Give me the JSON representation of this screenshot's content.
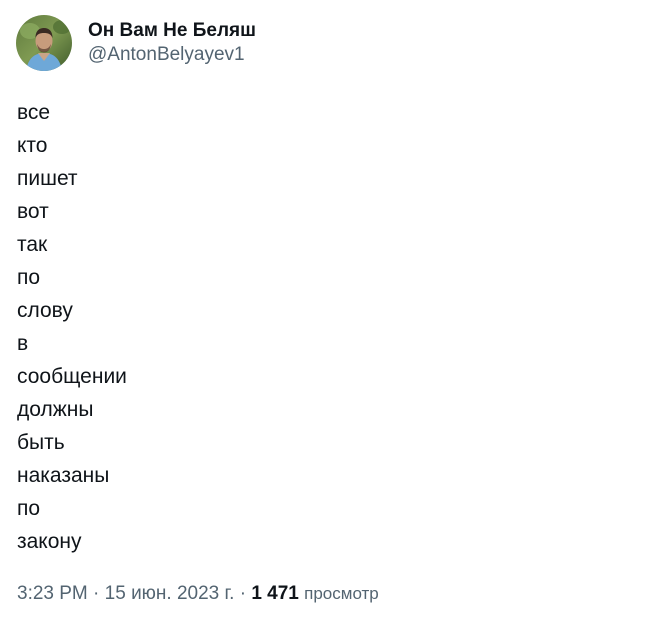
{
  "author": {
    "display_name": "Он Вам Не Беляш",
    "handle": "@AntonBelyayev1",
    "avatar_icon": "user-avatar-photo"
  },
  "tweet": {
    "lines": [
      "все",
      "кто",
      "пишет",
      "вот",
      "так",
      "по",
      "слову",
      "в",
      "сообщении",
      "должны",
      "быть",
      "наказаны",
      "по",
      "закону"
    ]
  },
  "meta": {
    "time": "3:23 PM",
    "separator": "·",
    "date": "15 июн. 2023 г.",
    "views_count": "1 471",
    "views_label": "просмотр"
  },
  "colors": {
    "text_primary": "#0f1419",
    "text_secondary": "#536471",
    "background": "#ffffff"
  }
}
